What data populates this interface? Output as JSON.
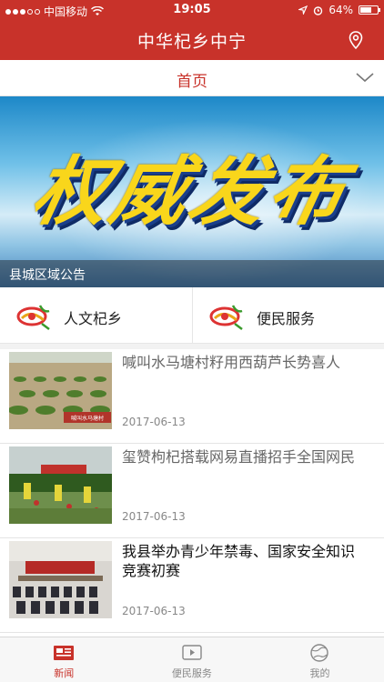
{
  "status_bar": {
    "carrier": "中国移动",
    "time": "19:05",
    "battery": "64%",
    "battery_level": 0.64
  },
  "nav": {
    "title": "中华杞乡中宁",
    "location_icon": "location-pin-icon"
  },
  "page_tab": {
    "label": "首页",
    "dropdown_icon": "chevron-down-icon"
  },
  "banner": {
    "headline": "权威发布",
    "caption": "县城区域公告"
  },
  "quick_links": [
    {
      "label": "人文杞乡",
      "icon": "goji-logo-icon"
    },
    {
      "label": "便民服务",
      "icon": "goji-logo-icon"
    }
  ],
  "news": [
    {
      "title": "喊叫水马塘村籽用西葫芦长势喜人",
      "date": "2017-06-13",
      "thumb_caption": "喊叫水马塘村"
    },
    {
      "title": "玺赞枸杞搭载网易直播招手全国网民",
      "date": "2017-06-13"
    },
    {
      "title": "我县举办青少年禁毒、国家安全知识竞赛初赛",
      "date": "2017-06-13"
    }
  ],
  "tab_bar": [
    {
      "label": "新闻",
      "icon": "newspaper-icon",
      "active": true
    },
    {
      "label": "便民服务",
      "icon": "play-icon",
      "active": false
    },
    {
      "label": "我的",
      "icon": "globe-icon",
      "active": false
    }
  ],
  "colors": {
    "brand_red": "#c8322a",
    "banner_yellow": "#f9d61b"
  }
}
